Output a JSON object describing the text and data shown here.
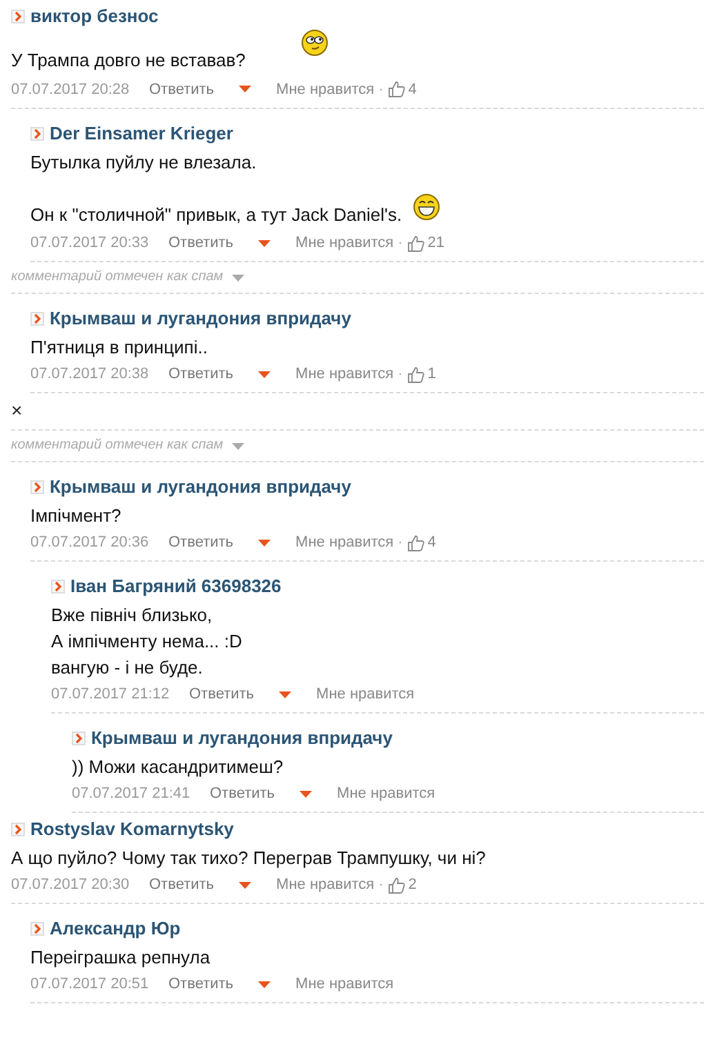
{
  "comments": [
    {
      "kind": "comment",
      "author": "виктор безнос",
      "paragraphs": [
        [
          "У Трампа довго не вставав?"
        ]
      ],
      "smiley": {
        "kind": "rolling-eyes"
      },
      "date": "07.07.2017 20:28",
      "reply": "Ответить",
      "like_label": "Мне нравится",
      "likes": {
        "sep": "·",
        "count": "4"
      },
      "children": [
        {
          "kind": "comment",
          "author": "Der Einsamer Krieger",
          "paragraphs": [
            [
              "Бутылка пуйлу не влезала."
            ],
            [
              "Он к \"столичной\" привык, а тут Jack Daniel's."
            ]
          ],
          "smiley": {
            "kind": "grin"
          },
          "date": "07.07.2017 20:33",
          "reply": "Ответить",
          "like_label": "Мне нравится",
          "likes": {
            "sep": "·",
            "count": "21"
          }
        }
      ]
    },
    {
      "kind": "spam",
      "label": "комментарий отмечен как спам",
      "children": [
        {
          "kind": "comment",
          "author": "Крымваш и лугандония впридачу",
          "paragraphs": [
            [
              "П'ятниця в принципі.."
            ]
          ],
          "date": "07.07.2017 20:38",
          "reply": "Ответить",
          "like_label": "Мне нравится",
          "likes": {
            "sep": "·",
            "count": "1"
          }
        }
      ]
    },
    {
      "kind": "close",
      "label": "×"
    },
    {
      "kind": "spam",
      "label": "комментарий отмечен как спам",
      "children": [
        {
          "kind": "comment",
          "author": "Крымваш и лугандония впридачу",
          "paragraphs": [
            [
              "Імпічмент?"
            ]
          ],
          "date": "07.07.2017 20:36",
          "reply": "Ответить",
          "like_label": "Мне нравится",
          "likes": {
            "sep": "·",
            "count": "4"
          },
          "children": [
            {
              "kind": "comment",
              "author": "Іван Багряний 63698326",
              "paragraphs": [
                [
                  "Вже північ близько,",
                  "А імпічменту нема... :D",
                  "вангую - і не буде."
                ]
              ],
              "date": "07.07.2017 21:12",
              "reply": "Ответить",
              "like_label": "Мне нравится",
              "children": [
                {
                  "kind": "comment",
                  "author": "Крымваш и лугандония впридачу",
                  "paragraphs": [
                    [
                      ")) Можи касандритимеш?"
                    ]
                  ],
                  "date": "07.07.2017 21:41",
                  "reply": "Ответить",
                  "like_label": "Мне нравится"
                }
              ]
            }
          ]
        }
      ]
    },
    {
      "kind": "comment",
      "author": "Rostyslav Komarnytsky",
      "paragraphs": [
        [
          "А що пуйло? Чому так тихо? Переграв Трампушку, чи ні?"
        ]
      ],
      "date": "07.07.2017 20:30",
      "reply": "Ответить",
      "like_label": "Мне нравится",
      "likes": {
        "sep": "·",
        "count": "2"
      },
      "children": [
        {
          "kind": "comment",
          "author": "Александр Юр",
          "paragraphs": [
            [
              "Переіграшка репнула"
            ]
          ],
          "date": "07.07.2017 20:51",
          "reply": "Ответить",
          "like_label": "Мне нравится"
        }
      ]
    }
  ]
}
